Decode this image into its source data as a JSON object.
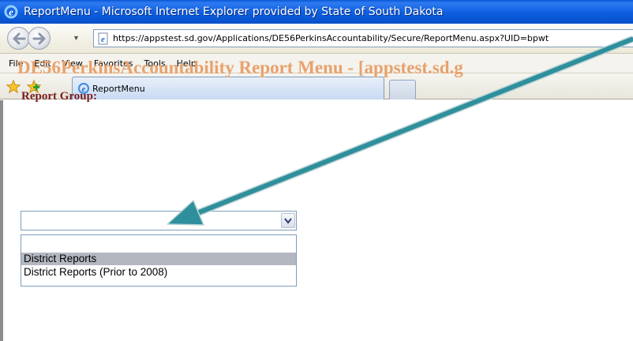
{
  "window": {
    "title": "ReportMenu - Microsoft Internet Explorer provided by State of South Dakota"
  },
  "navigation": {
    "url": "https://appstest.sd.gov/Applications/DE56PerkinsAccountability/Secure/ReportMenu.aspx?UID=bpwt"
  },
  "menu": {
    "items": [
      "File",
      "Edit",
      "View",
      "Favorites",
      "Tools",
      "Help"
    ]
  },
  "tabs": {
    "active_label": "ReportMenu"
  },
  "page": {
    "title": "DE56PerkinsAccountability Report Menu - [appstest.sd.g",
    "report_group_label": "Report Group:",
    "select": {
      "selected_value": "",
      "options": [
        "",
        "District Reports",
        "District Reports (Prior to 2008)"
      ],
      "highlighted_option": "District Reports"
    }
  },
  "colors": {
    "title_color": "#e8a26c",
    "label_color": "#7a1e1e",
    "arrow_color": "#2f8f9c",
    "highlight": "#b3b7c0"
  },
  "icons": {
    "app": "ie-logo-icon",
    "back": "back-arrow-icon",
    "forward": "forward-arrow-icon",
    "favorites": "star-icon",
    "add_favorites": "add-favorites-icon",
    "dropdown": "chevron-down-icon"
  }
}
